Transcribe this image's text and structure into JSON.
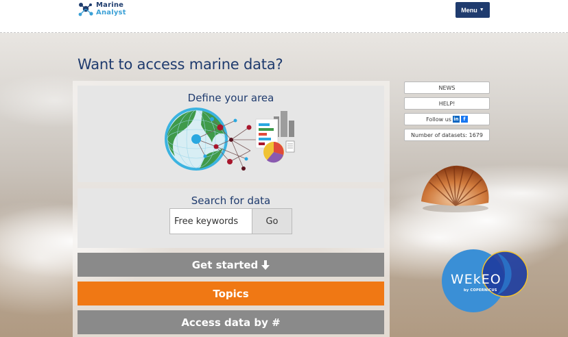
{
  "header": {
    "logo_line1": "Marine",
    "logo_line2": "Analyst",
    "menu_label": "Menu"
  },
  "page": {
    "title": "Want to access marine data?"
  },
  "define_area": {
    "title": "Define your area"
  },
  "search": {
    "title": "Search for data",
    "placeholder": "Free keywords",
    "go_label": "Go"
  },
  "buttons": {
    "get_started": "Get started",
    "topics": "Topics",
    "access_by": "Access data by #"
  },
  "sidebar": {
    "news": "NEWS",
    "help": "HELP!",
    "follow": "Follow us",
    "datasets": "Number of datasets: 1679"
  },
  "wekeo": {
    "name": "WEkEO",
    "by": "by COPERNICUS"
  },
  "colors": {
    "navy": "#1f3b6e",
    "orange": "#f07814",
    "grey_button": "#8a8a8a",
    "linkedin": "#0a66c2",
    "facebook": "#1877f2",
    "wekeo_blue": "#3a8fd6"
  },
  "icons": {
    "menu": "caret-down-icon",
    "get_started": "arrow-down-icon",
    "linkedin": "linkedin-icon",
    "facebook": "facebook-icon"
  }
}
